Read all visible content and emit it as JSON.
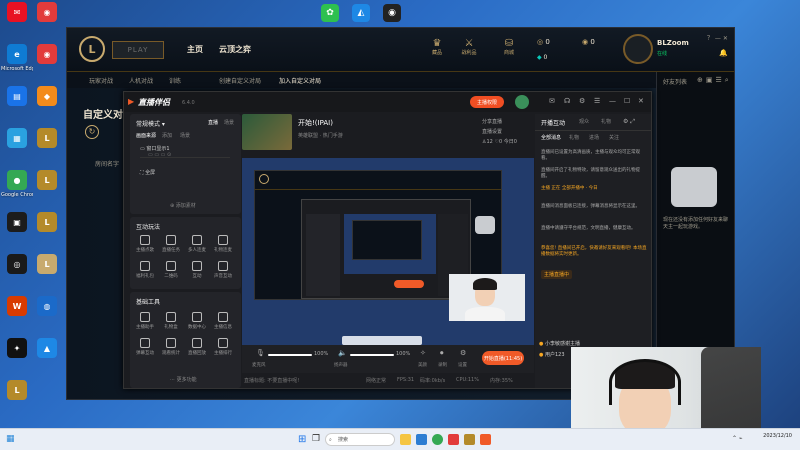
{
  "desktop_icons": [
    {
      "label": "",
      "color": "#e81123",
      "glyph": "✉"
    },
    {
      "label": "",
      "color": "#e23b3b",
      "glyph": "◉"
    },
    {
      "label": "Microsoft Edge",
      "color": "#0f7bd3",
      "glyph": "e"
    },
    {
      "label": "",
      "color": "#e23b3b",
      "glyph": "◉"
    },
    {
      "label": "",
      "color": "#1a73e8",
      "glyph": "▤"
    },
    {
      "label": "",
      "color": "#f38b1b",
      "glyph": "◆"
    },
    {
      "label": "",
      "color": "#2aa1e0",
      "glyph": "▦"
    },
    {
      "label": "",
      "color": "#b48a2a",
      "glyph": "L"
    },
    {
      "label": "Google Chrome",
      "color": "#34a853",
      "glyph": "●"
    },
    {
      "label": "",
      "color": "#b48a2a",
      "glyph": "L"
    },
    {
      "label": "",
      "color": "#1c1c1c",
      "glyph": "▣"
    },
    {
      "label": "",
      "color": "#b48a2a",
      "glyph": "L"
    },
    {
      "label": "",
      "color": "#1a1a1a",
      "glyph": "◎"
    },
    {
      "label": "",
      "color": "#c8aa6e",
      "glyph": "L"
    },
    {
      "label": "",
      "color": "#d83b01",
      "glyph": "W"
    },
    {
      "label": "",
      "color": "#1b6ac9",
      "glyph": "◍"
    },
    {
      "label": "",
      "color": "#111111",
      "glyph": "✦"
    },
    {
      "label": "",
      "color": "#1e88e5",
      "glyph": "▲"
    },
    {
      "label": "",
      "color": "#b48a2a",
      "glyph": "L"
    }
  ],
  "top_apps": [
    {
      "color": "#2ec050",
      "glyph": "✿"
    },
    {
      "color": "#1e88e5",
      "glyph": "◭"
    },
    {
      "color": "#222222",
      "glyph": "◉"
    }
  ],
  "lol": {
    "play_label": "PLAY",
    "nav": [
      "主页",
      "云顶之弈"
    ],
    "subnav": [
      "玩家对战",
      "人机对战",
      "训练",
      "创建自定义对局",
      "加入自定义对局"
    ],
    "page_title": "自定义对",
    "content_label": "房间名字",
    "top_icons": [
      {
        "glyph": "♛",
        "label": "藏品"
      },
      {
        "glyph": "⚔",
        "label": "战利品"
      },
      {
        "glyph": "⛁",
        "label": "商城"
      }
    ],
    "currency_be": "0",
    "currency_rp": "0",
    "currency_other": "0",
    "summoner_name": "BLZoom",
    "summoner_status": "在线",
    "friends_title": "好友列表",
    "friends_empty": "现在还没有添加任何好友来聊天主一起玩游戏。"
  },
  "stream": {
    "brand": "直播伴侣",
    "version": "6.4.0",
    "live_button": "主播权限",
    "title_icons": [
      "消息",
      "设置",
      "帮助"
    ],
    "room_title": "开始!(IPAI)",
    "room_sub": "英雄联盟 · 热门手游",
    "room_actions": [
      "分享直播",
      "直播设置"
    ],
    "room_stats": [
      "12",
      "0",
      "今日0"
    ],
    "scene_panel": {
      "title": "常规模式",
      "tabs": [
        "直播",
        "场景"
      ],
      "source_tabs": [
        "画面来源",
        "添加",
        "场景"
      ],
      "items": [
        "窗口显示1",
        "全屏"
      ],
      "add_label": "添加素材"
    },
    "interaction": {
      "title": "互动玩法",
      "items": [
        "主播点歌",
        "直播任务",
        "多人连麦",
        "礼物连麦",
        "福利礼包",
        "二维码",
        "互动",
        "声音互动"
      ]
    },
    "tools": {
      "title": "基础工具",
      "items": [
        "主播助手",
        "礼物盒",
        "数据中心",
        "主播信息",
        "弹幕互动",
        "观看统计",
        "直播回放",
        "主播排行"
      ],
      "more": "更多功能"
    },
    "controls": {
      "mic_label": "麦克风",
      "mic_value": "100%",
      "speaker_label": "扬声器",
      "speaker_value": "100%",
      "buttons": [
        "美颜",
        "录制",
        "设置"
      ],
      "start_live": "开始直播(11:45)"
    },
    "status": {
      "left": "直播标题: 不要直播中呢!",
      "fps": "FPS:31",
      "cpu": "CPU:11%",
      "network": "网络正常",
      "bitrate": "码率:0kb/s",
      "mem": "内存:35%"
    },
    "chat": {
      "tabs": [
        "开播互动",
        "观众",
        "礼物"
      ],
      "subtabs": [
        "全部消息",
        "礼物",
        "进场",
        "关注"
      ],
      "lines": [
        "直播间已设置为高清画质，主播与观众均可正常观看。",
        "直播间开启了礼物特效，请留意观众送出的礼物提醒。",
        "主播 正在 全部开播中 · 今日",
        "直播间消息面板已连接，弹幕消息将显示在这里。",
        "直播中请遵守平台规范，文明直播，健康互动。",
        "恭喜您! 直播间已开启，快邀请好友来观看吧! 本场直播数据将实时更新。"
      ],
      "highlight": "主播直播中",
      "bottom_users": [
        "小李敏感谢主播",
        "用户123"
      ]
    }
  },
  "taskbar": {
    "search_placeholder": "搜索",
    "time": "",
    "date": "2023/12/10"
  }
}
